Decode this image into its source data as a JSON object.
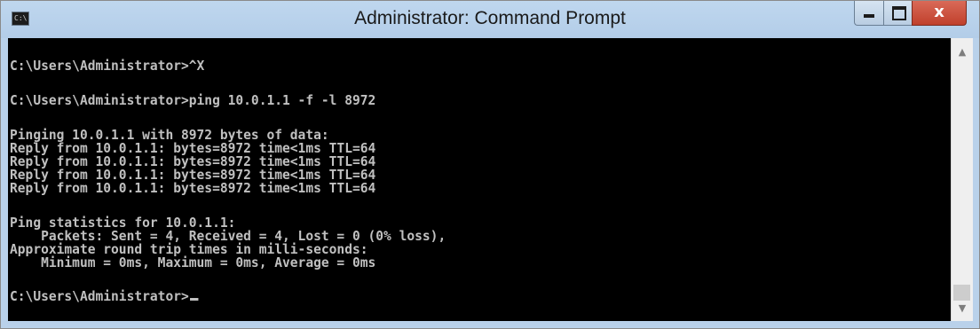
{
  "window": {
    "title": "Administrator: Command Prompt",
    "icon": "cmd-icon",
    "icon_text": "C:\\"
  },
  "controls": {
    "minimize_icon": "minimize-icon",
    "maximize_icon": "maximize-icon",
    "close_label": "x"
  },
  "console": {
    "lines": [
      "C:\\Users\\Administrator>^X",
      "C:\\Users\\Administrator>ping 10.0.1.1 -f -l 8972",
      "Pinging 10.0.1.1 with 8972 bytes of data:",
      "Reply from 10.0.1.1: bytes=8972 time<1ms TTL=64",
      "Reply from 10.0.1.1: bytes=8972 time<1ms TTL=64",
      "Reply from 10.0.1.1: bytes=8972 time<1ms TTL=64",
      "Reply from 10.0.1.1: bytes=8972 time<1ms TTL=64",
      "Ping statistics for 10.0.1.1:",
      "    Packets: Sent = 4, Received = 4, Lost = 0 (0% loss),",
      "Approximate round trip times in milli-seconds:",
      "    Minimum = 0ms, Maximum = 0ms, Average = 0ms",
      "C:\\Users\\Administrator>"
    ]
  },
  "scrollbar": {
    "up_arrow": "▲",
    "down_arrow": "▼"
  },
  "colors": {
    "console_bg": "#000000",
    "console_text": "#c0c0c0",
    "titlebar": "#b9d1ea",
    "close_button": "#c7432f"
  }
}
